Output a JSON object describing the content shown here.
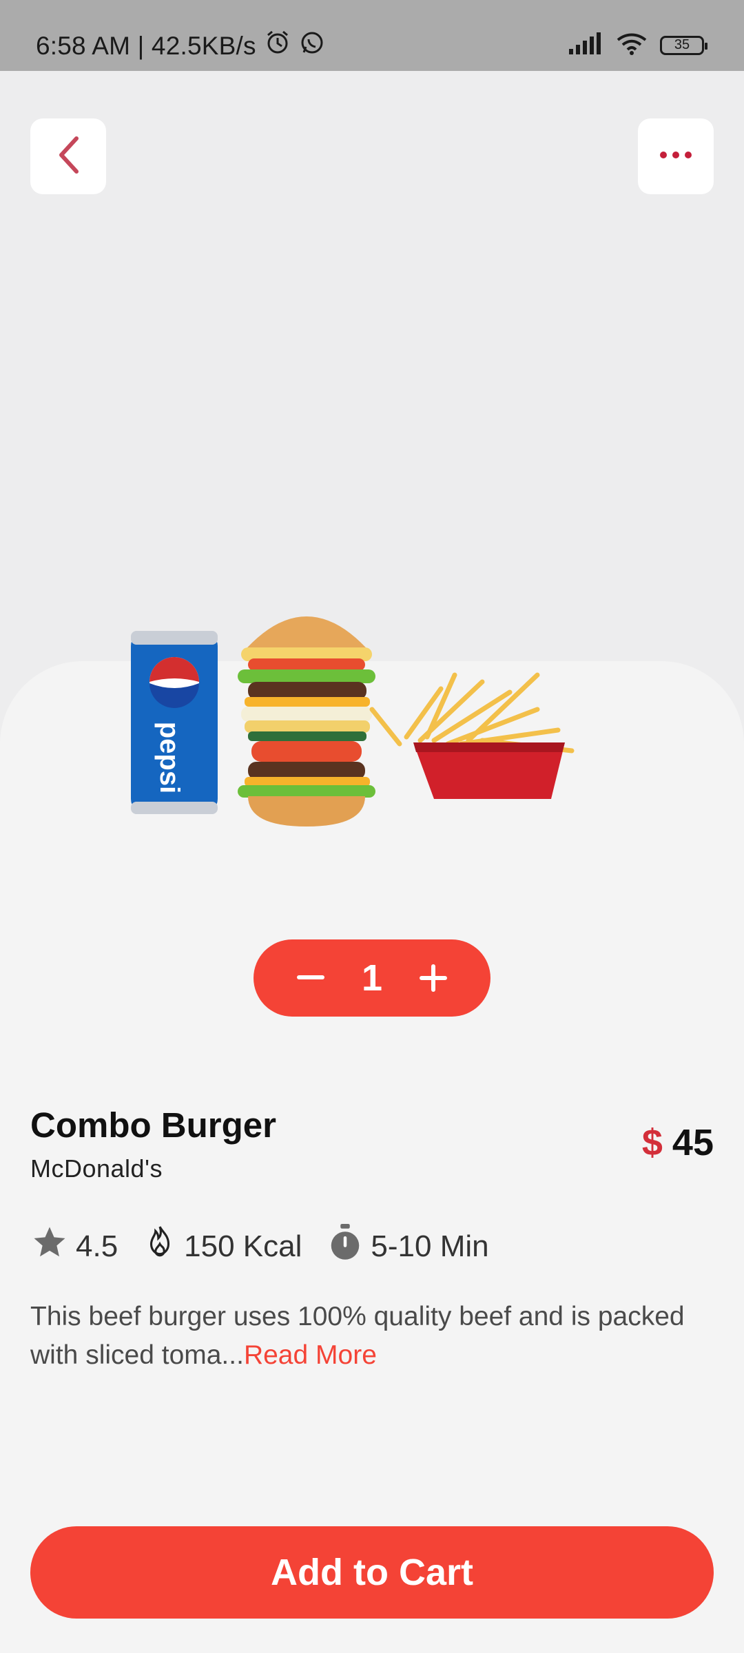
{
  "status_bar": {
    "time_speed": "6:58 AM | 42.5KB/s",
    "battery": "35",
    "icons": [
      "alarm-icon",
      "whatsapp-icon",
      "signal-icon",
      "wifi-icon",
      "battery-icon"
    ]
  },
  "header": {
    "back_icon": "chevron-left-icon",
    "menu_icon": "more-dots-icon"
  },
  "product": {
    "image_alt": "Pepsi can, double cheeseburger and fries",
    "quantity": "1",
    "name": "Combo Burger",
    "restaurant": "McDonald's",
    "currency": "$",
    "price": "45",
    "rating": "4.5",
    "calories": "150 Kcal",
    "time": "5-10 Min",
    "description": "This beef burger uses 100% quality beef and is packed with sliced toma...",
    "read_more": "Read More"
  },
  "cta": {
    "label": "Add to Cart"
  },
  "colors": {
    "accent": "#f44336",
    "price_currency": "#d32f3a"
  }
}
